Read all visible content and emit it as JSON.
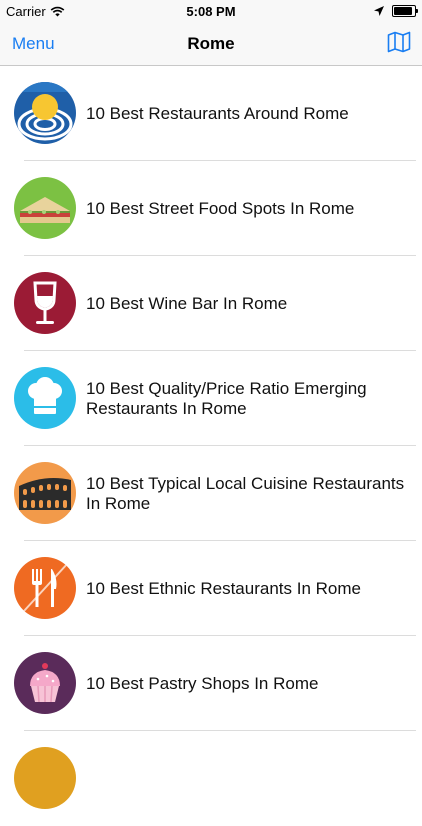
{
  "status_bar": {
    "carrier": "Carrier",
    "time": "5:08 PM"
  },
  "nav": {
    "left_label": "Menu",
    "title": "Rome",
    "right_icon": "map-icon"
  },
  "colors": {
    "accent": "#1a7ef2"
  },
  "items": [
    {
      "label": "10 Best Restaurants Around Rome",
      "icon": "sunrise-plate-icon"
    },
    {
      "label": "10 Best Street Food Spots In Rome",
      "icon": "sandwich-icon"
    },
    {
      "label": "10 Best Wine Bar In Rome",
      "icon": "wine-glass-icon"
    },
    {
      "label": "10 Best Quality/Price Ratio Emerging Restaurants In Rome",
      "icon": "chef-hat-icon"
    },
    {
      "label": "10 Best Typical Local Cuisine Restaurants In Rome",
      "icon": "colosseum-icon"
    },
    {
      "label": "10 Best Ethnic Restaurants In Rome",
      "icon": "fork-knife-icon"
    },
    {
      "label": "10 Best Pastry Shops In Rome",
      "icon": "cupcake-icon"
    },
    {
      "label": "",
      "icon": "partial-icon"
    }
  ]
}
